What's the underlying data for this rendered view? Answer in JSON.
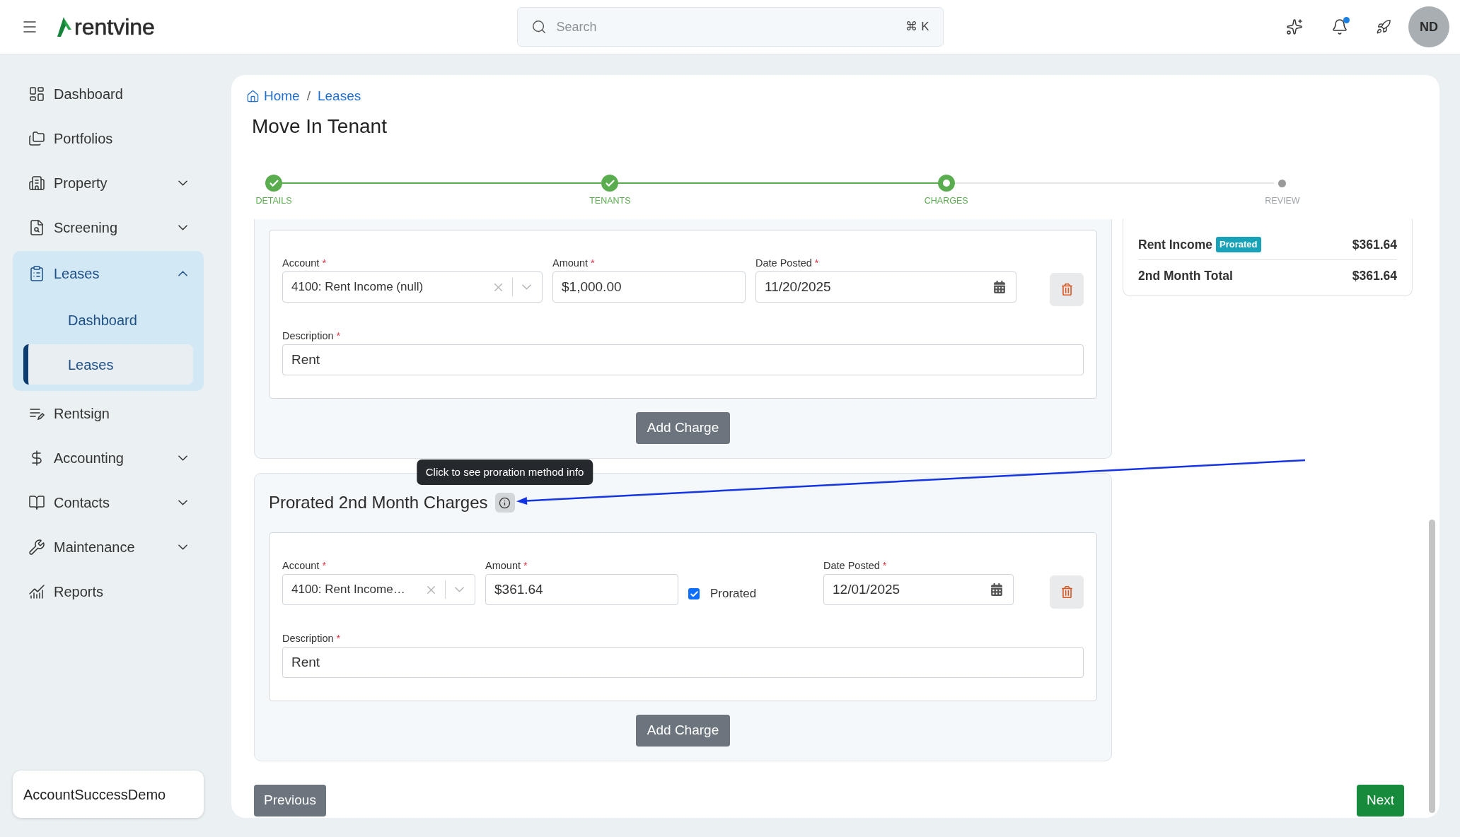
{
  "topbar": {
    "logo": "rentvine",
    "search": {
      "placeholder": "Search",
      "shortcut": "⌘ K"
    },
    "notifications": {
      "unread": true
    },
    "avatar": "ND"
  },
  "sidebar": {
    "items": [
      {
        "label": "Dashboard",
        "kind": "link",
        "selected": false
      },
      {
        "label": "Portfolios",
        "kind": "link",
        "selected": false
      },
      {
        "label": "Property",
        "kind": "group",
        "selected": false,
        "expanded": false
      },
      {
        "label": "Screening",
        "kind": "group",
        "selected": false,
        "expanded": false
      },
      {
        "label": "Leases",
        "kind": "group",
        "selected": true,
        "expanded": true,
        "children": [
          {
            "label": "Dashboard",
            "selected": false
          },
          {
            "label": "Leases",
            "selected": true
          }
        ]
      },
      {
        "label": "Rentsign",
        "kind": "link",
        "selected": false
      },
      {
        "label": "Accounting",
        "kind": "group",
        "selected": false,
        "expanded": false
      },
      {
        "label": "Contacts",
        "kind": "group",
        "selected": false,
        "expanded": false
      },
      {
        "label": "Maintenance",
        "kind": "group",
        "selected": false,
        "expanded": false
      },
      {
        "label": "Reports",
        "kind": "link",
        "selected": false
      }
    ],
    "account": "AccountSuccessDemo"
  },
  "page": {
    "breadcrumb": {
      "separator": "/",
      "items": [
        {
          "label": "Home"
        },
        {
          "label": "Leases"
        }
      ]
    },
    "title": "Move In Tenant",
    "steps": [
      {
        "label": "DETAILS",
        "completed": true,
        "reached": true
      },
      {
        "label": "TENANTS",
        "completed": true,
        "reached": true
      },
      {
        "label": "CHARGES",
        "completed": false,
        "reached": true
      },
      {
        "label": "REVIEW",
        "completed": false,
        "reached": false
      }
    ],
    "sections": [
      {
        "charges": [
          {
            "fields": [
              {
                "kind": "select",
                "label": "Account",
                "required_mark": "*",
                "value": "4100: Rent Income (null)"
              },
              {
                "kind": "text",
                "label": "Amount",
                "required_mark": "*",
                "value": "$1,000.00"
              },
              {
                "kind": "date",
                "label": "Date Posted",
                "required_mark": "*",
                "value": "11/20/2025"
              }
            ],
            "description": {
              "label": "Description",
              "required_mark": "*",
              "value": "Rent"
            }
          }
        ],
        "add_button": "Add Charge"
      },
      {
        "title": "Prorated 2nd Month Charges",
        "tooltip": "Click to see proration method info",
        "charges": [
          {
            "fields": [
              {
                "kind": "select",
                "label": "Account",
                "required_mark": "*",
                "value": "4100: Rent Income…"
              },
              {
                "kind": "text",
                "label": "Amount",
                "required_mark": "*",
                "value": "$361.64"
              },
              {
                "kind": "checkbox",
                "label": "Prorated",
                "checked": true
              },
              {
                "kind": "date",
                "label": "Date Posted",
                "required_mark": "*",
                "value": "12/01/2025"
              }
            ],
            "description": {
              "label": "Description",
              "required_mark": "*",
              "value": "Rent"
            }
          }
        ],
        "add_button": "Add Charge"
      }
    ],
    "summary": {
      "lines": [
        {
          "label": "Rent Income",
          "badge": "Prorated",
          "amount": "$361.64"
        }
      ],
      "total": {
        "label": "2nd Month Total",
        "amount": "$361.64"
      }
    },
    "footer": {
      "previous": "Previous",
      "next": "Next"
    }
  }
}
